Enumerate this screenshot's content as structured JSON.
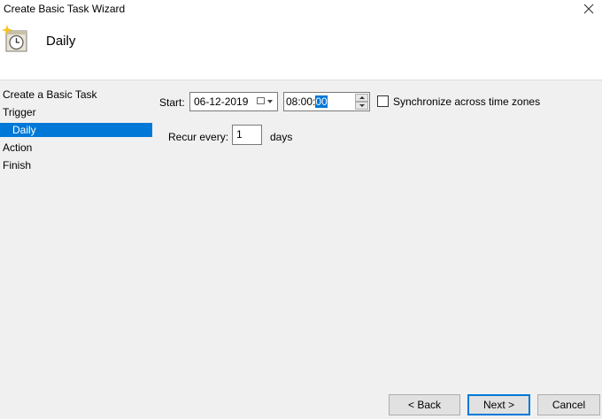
{
  "window": {
    "title": "Create Basic Task Wizard"
  },
  "header": {
    "title": "Daily"
  },
  "nav": {
    "items": [
      {
        "label": "Create a Basic Task"
      },
      {
        "label": "Trigger"
      },
      {
        "label": "Daily"
      },
      {
        "label": "Action"
      },
      {
        "label": "Finish"
      }
    ]
  },
  "form": {
    "start_label": "Start:",
    "date_value": "06-12-2019",
    "time_prefix": "08:00:",
    "time_selected": "00",
    "sync_label": "Synchronize across time zones",
    "sync_checked": false,
    "recur_label": "Recur every:",
    "recur_value": "1",
    "recur_unit": "days"
  },
  "buttons": {
    "back": "< Back",
    "next": "Next >",
    "cancel": "Cancel"
  },
  "colors": {
    "accent": "#0078d7"
  }
}
